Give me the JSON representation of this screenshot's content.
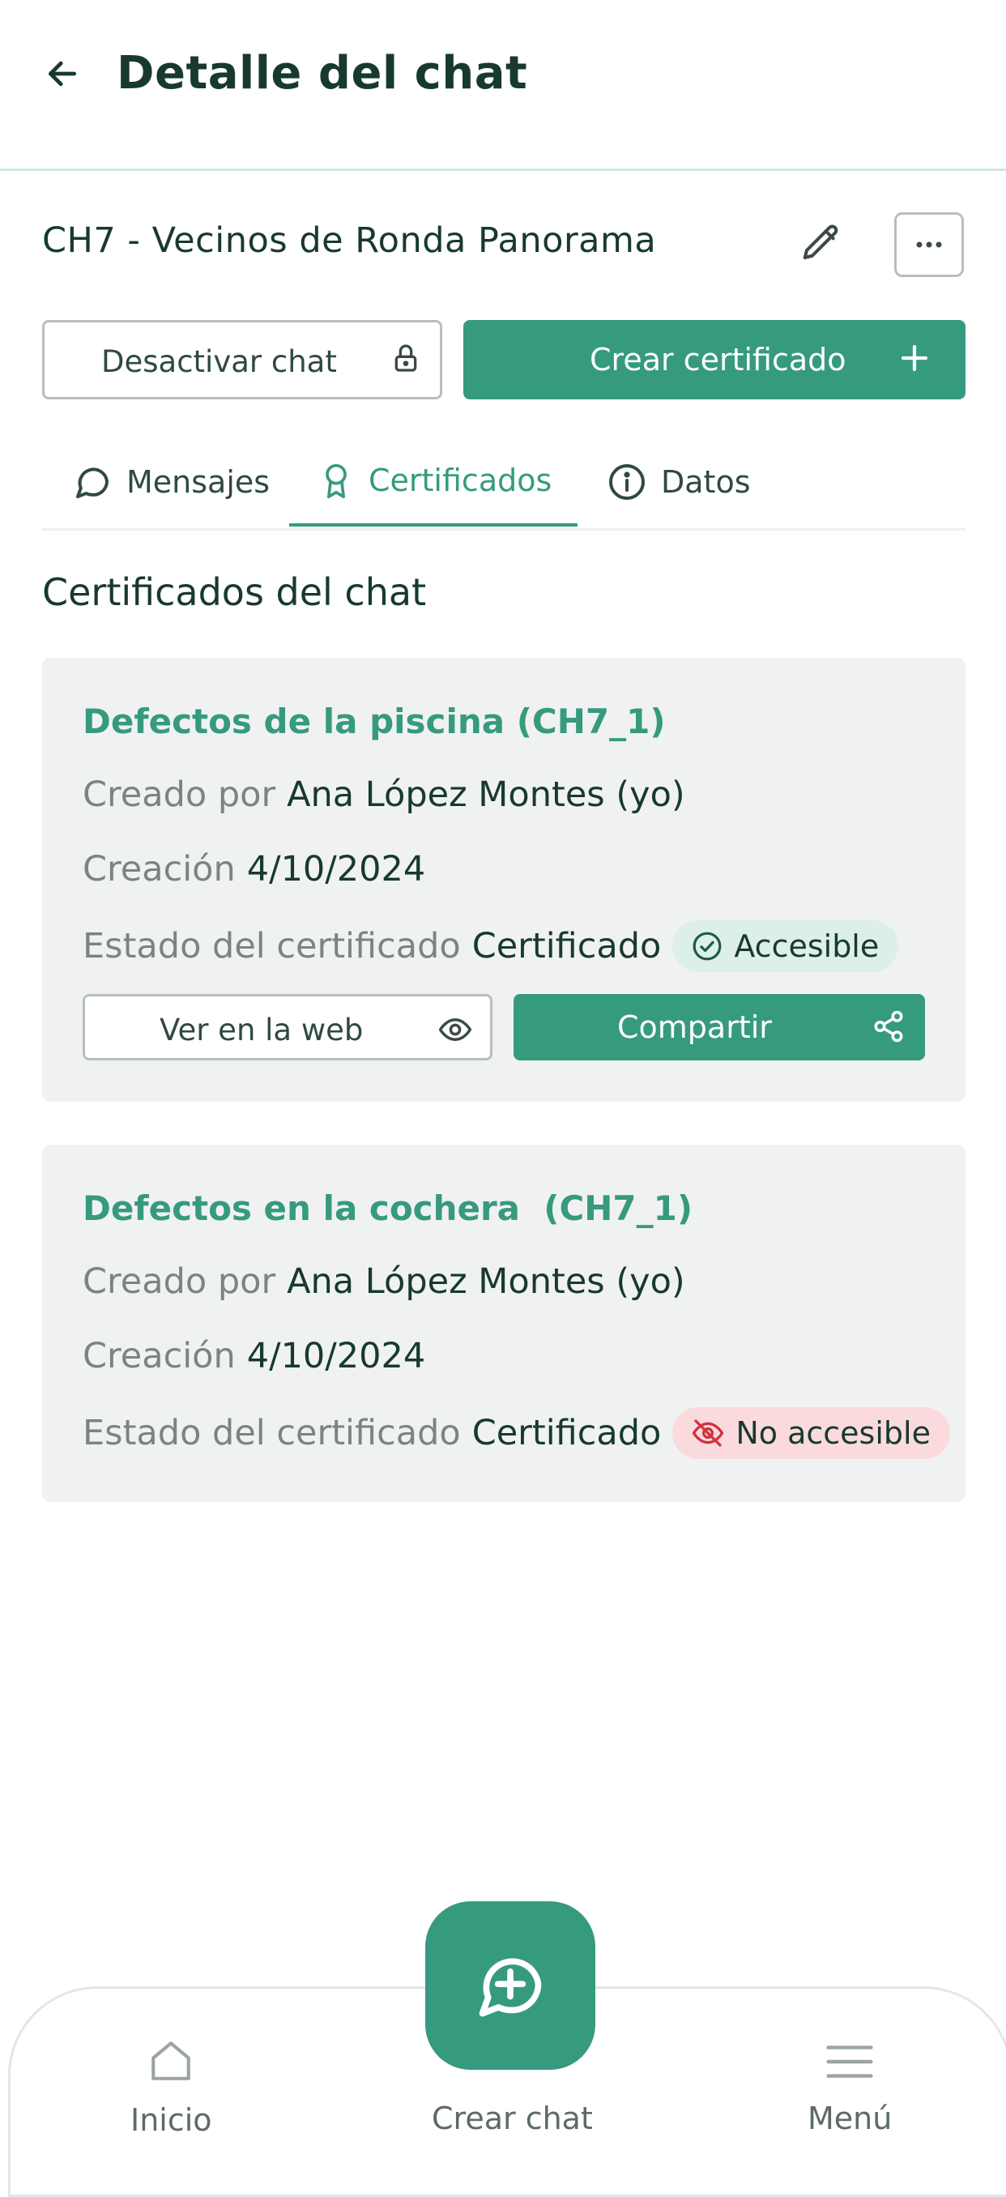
{
  "header": {
    "title": "Detalle del chat"
  },
  "chat": {
    "name": "CH7 - Vecinos de Ronda Panorama",
    "deactivate_label": "Desactivar chat",
    "create_certificate_label": "Crear certificado"
  },
  "tabs": [
    {
      "label": "Mensajes",
      "icon": "message-circle-icon",
      "active": false
    },
    {
      "label": "Certificados",
      "icon": "award-icon",
      "active": true
    },
    {
      "label": "Datos",
      "icon": "info-icon",
      "active": false
    }
  ],
  "section_title": "Certificados del chat",
  "certificates": [
    {
      "title": "Defectos de la piscina (CH7_1)",
      "created_by_label": "Creado por",
      "created_by": "Ana López Montes (yo)",
      "creation_label": "Creación",
      "creation_date": "4/10/2024",
      "status_label": "Estado del certificado",
      "status": "Certificado",
      "access_badge": "Accesible",
      "view_web_label": "Ver en la web",
      "share_label": "Compartir"
    },
    {
      "title": "Defectos en la cochera  (CH7_1)",
      "created_by_label": "Creado por",
      "created_by": "Ana López Montes (yo)",
      "creation_label": "Creación",
      "creation_date": "4/10/2024",
      "status_label": "Estado del certificado",
      "status": "Certificado",
      "access_badge": "No accesible"
    }
  ],
  "bottom_nav": {
    "home_label": "Inicio",
    "create_chat_label": "Crear chat",
    "menu_label": "Menú"
  },
  "colors": {
    "brand": "#369a7f",
    "text_dark": "#173a2c",
    "badge_ok_bg": "#dcefe8",
    "badge_no_bg": "#fbdadd",
    "badge_no_icon": "#d0323f"
  }
}
